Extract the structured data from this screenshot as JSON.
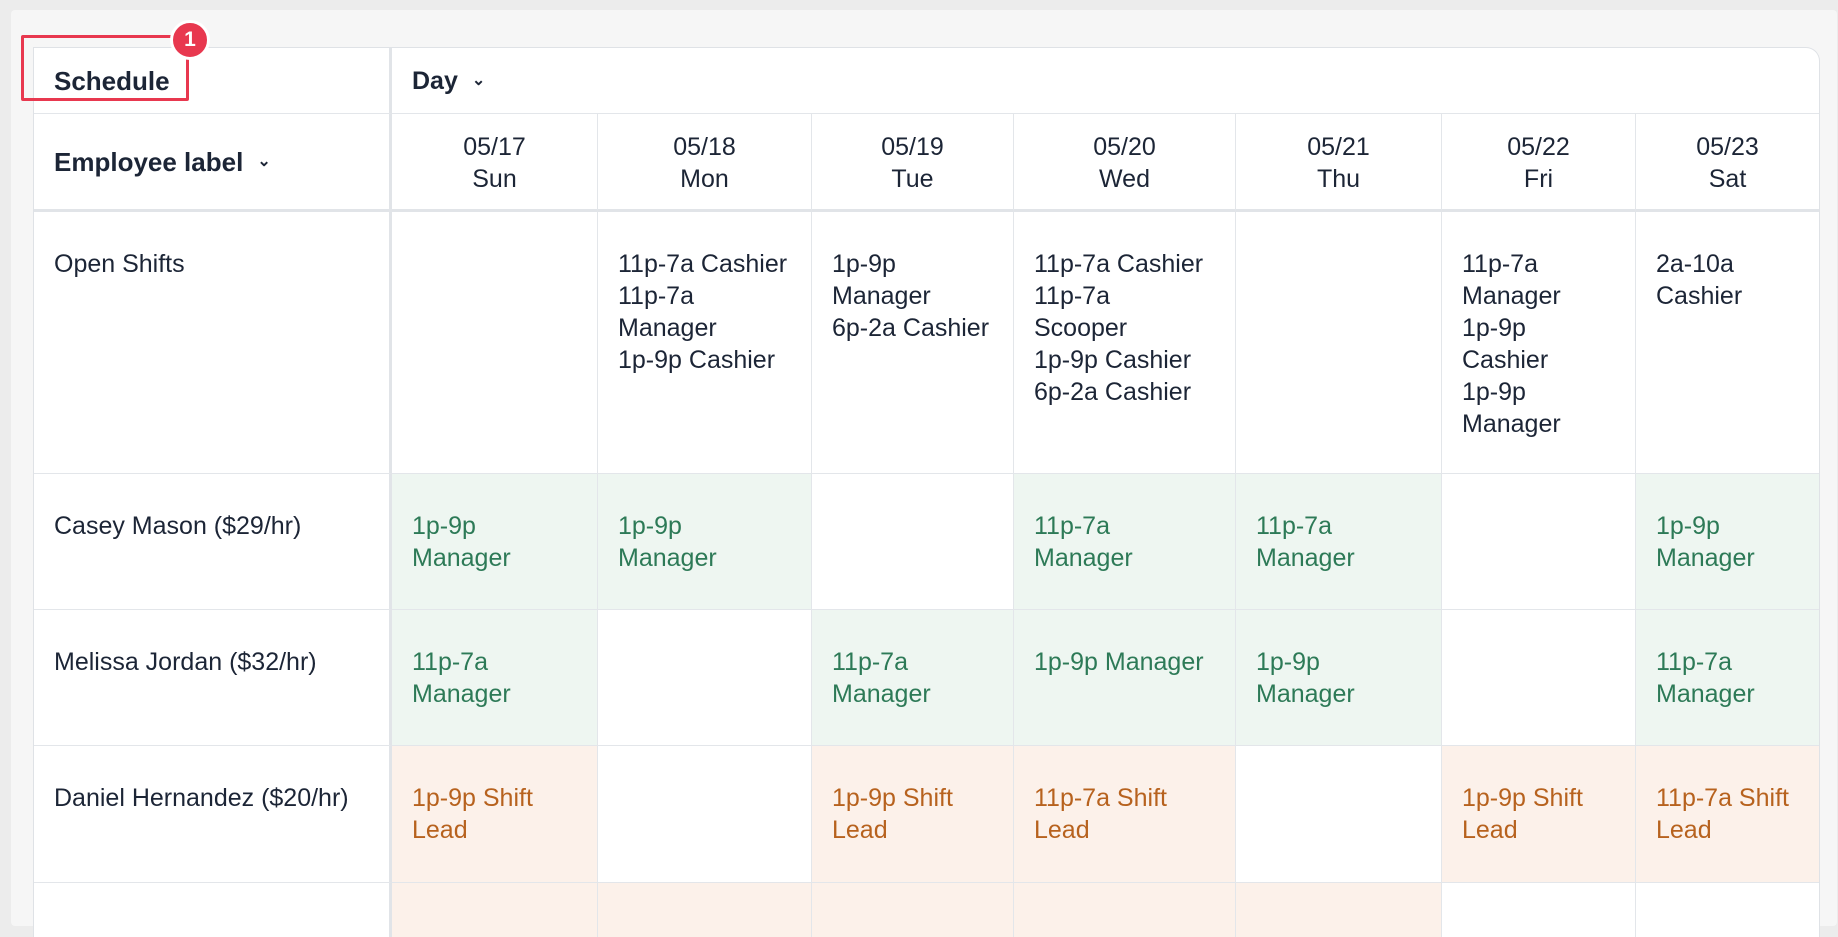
{
  "header": {
    "schedule_label": "Schedule",
    "view_label": "Day",
    "employee_label": "Employee label",
    "badge_number": "1"
  },
  "days": [
    {
      "date": "05/17",
      "weekday": "Sun"
    },
    {
      "date": "05/18",
      "weekday": "Mon"
    },
    {
      "date": "05/19",
      "weekday": "Tue"
    },
    {
      "date": "05/20",
      "weekday": "Wed"
    },
    {
      "date": "05/21",
      "weekday": "Thu"
    },
    {
      "date": "05/22",
      "weekday": "Fri"
    },
    {
      "date": "05/23",
      "weekday": "Sat"
    }
  ],
  "colors": {
    "green_bg": "#eef6f1",
    "green_text": "#2d7a57",
    "orange_bg": "#fcf1ea",
    "orange_text": "#b7621e",
    "highlight": "#e8384f"
  },
  "rows": [
    {
      "label": "Open Shifts",
      "style": "plain",
      "cells": [
        "",
        "11p-7a Cashier\n11p-7a\nManager\n1p-9p Cashier",
        "1p-9p\nManager\n6p-2a Cashier",
        "11p-7a Cashier\n11p-7a\nScooper\n1p-9p Cashier\n6p-2a Cashier",
        "",
        "11p-7a\nManager\n1p-9p\nCashier\n1p-9p\nManager",
        "2a-10a\nCashier"
      ]
    },
    {
      "label": "Casey Mason ($29/hr)",
      "style": "green",
      "cells": [
        "1p-9p\nManager",
        "1p-9p\nManager",
        "",
        "11p-7a\nManager",
        "11p-7a\nManager",
        "",
        "1p-9p\nManager"
      ]
    },
    {
      "label": "Melissa Jordan ($32/hr)",
      "style": "green",
      "cells": [
        "11p-7a\nManager",
        "",
        "11p-7a\nManager",
        "1p-9p Manager",
        "1p-9p\nManager",
        "",
        "11p-7a\nManager"
      ]
    },
    {
      "label": "Daniel Hernandez ($20/hr)",
      "style": "orange",
      "cells": [
        "1p-9p Shift\nLead",
        "",
        "1p-9p Shift\nLead",
        "11p-7a Shift\nLead",
        "",
        "1p-9p Shift\nLead",
        "11p-7a Shift\nLead"
      ]
    },
    {
      "label": "",
      "style": "orange",
      "cells": [
        "",
        "",
        "",
        "",
        "",
        "",
        ""
      ],
      "filled": [
        true,
        true,
        true,
        true,
        true,
        false,
        false
      ]
    }
  ]
}
